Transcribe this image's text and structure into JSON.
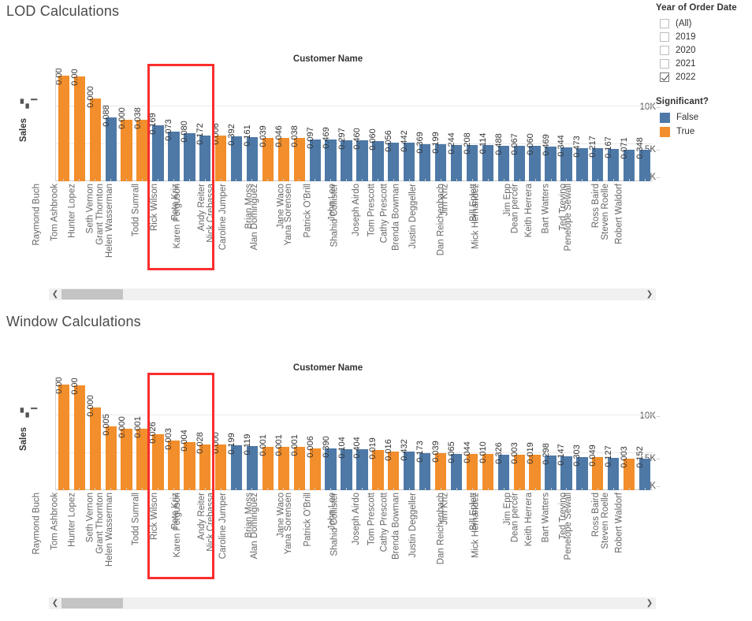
{
  "filters": {
    "title": "Year of Order Date",
    "options": [
      {
        "label": "(All)",
        "checked": false
      },
      {
        "label": "2019",
        "checked": false
      },
      {
        "label": "2020",
        "checked": false
      },
      {
        "label": "2021",
        "checked": false
      },
      {
        "label": "2022",
        "checked": true
      }
    ]
  },
  "legend": {
    "title": "Significant?",
    "items": [
      {
        "label": "False",
        "color": "#4e79a7"
      },
      {
        "label": "True",
        "color": "#f28e2b"
      }
    ]
  },
  "colors": {
    "false_blue": "#4e79a7",
    "true_orange": "#f28e2b",
    "highlight_red": "#fb2e2e"
  },
  "charts": [
    {
      "title": "LOD Calculations",
      "column_header": "Customer Name",
      "y_axis_title": "Sales",
      "y_ticks": [
        "10K",
        "5K",
        "0K"
      ],
      "scrollbar": {
        "left_arrow": "❮",
        "right_arrow": "❯"
      },
      "highlight": {
        "from": "Todd Sumrall",
        "to": "Karen Ferguson"
      }
    },
    {
      "title": "Window Calculations",
      "column_header": "Customer Name",
      "y_axis_title": "Sales",
      "y_ticks": [
        "10K",
        "5K",
        "0K"
      ],
      "scrollbar": {
        "left_arrow": "❮",
        "right_arrow": "❯"
      },
      "highlight": {
        "from": "Todd Sumrall",
        "to": "Karen Ferguson"
      }
    }
  ],
  "chart_data": [
    {
      "type": "bar",
      "title": "LOD Calculations",
      "xlabel": "Customer Name",
      "ylabel": "Sales",
      "ylim": [
        0,
        15000
      ],
      "yticks": [
        0,
        5000,
        10000
      ],
      "ytick_labels": [
        "0K",
        "5K",
        "10K"
      ],
      "grid": true,
      "legend": "Significant?",
      "value_label_note": "p-value printed above each bar; bar height = Sales",
      "categories": [
        "Raymond Buch",
        "Tom Ashbrook",
        "Hunter Lopez",
        "Seth Vernon",
        "Grant Thornton",
        "Helen Wasserman",
        "Todd Sumrall",
        "Rick Wilson",
        "Pete Kriz",
        "Karen Ferguson",
        "Andy Reiter",
        "Nick Crebassa",
        "Caroline Jumper",
        "Brian Moss",
        "Alan Dominguez",
        "Jane Waco",
        "Yana Sorensen",
        "Patrick O'Brill",
        "John Lee",
        "Shahid Collister",
        "Joseph Airdo",
        "Tom Prescott",
        "Cathy Prescott",
        "Brenda Bowman",
        "Justin Deggeller",
        "Jim Kriz",
        "Dan Reichenbach",
        "Bill Eplett",
        "Mick Hernandez",
        "Jim Epp",
        "Dean percer",
        "Keith Herrera",
        "Bart Watters",
        "Ted Trevino",
        "Penelope Sewall",
        "Ross Baird",
        "Steven Roelle",
        "Robert Waldorf"
      ],
      "values": [
        14100,
        14000,
        11050,
        8450,
        8150,
        8150,
        7500,
        6650,
        6350,
        6100,
        6050,
        5950,
        5850,
        5800,
        5750,
        5750,
        5600,
        5550,
        5500,
        5450,
        5300,
        5150,
        5100,
        4950,
        4900,
        4850,
        4800,
        4800,
        4750,
        4700,
        4700,
        4650,
        4500,
        4450,
        4400,
        4350,
        4200,
        4150
      ],
      "data_labels": [
        "0.000",
        "0.000",
        "0.000",
        "0.088",
        "0.000",
        "0.038",
        "0.169",
        "0.073",
        "0.080",
        "0.172",
        "0.006",
        "0.392",
        "0.161",
        "0.039",
        "0.046",
        "0.038",
        "0.097",
        "0.469",
        "0.297",
        "0.460",
        "0.060",
        "0.056",
        "0.442",
        "0.369",
        "0.199",
        "0.244",
        "0.208",
        "0.114",
        "0.488",
        "0.067",
        "0.060",
        "0.469",
        "0.344",
        "0.473",
        "0.217",
        "0.167",
        "0.071",
        "0.348"
      ],
      "significant": [
        true,
        true,
        true,
        false,
        true,
        true,
        false,
        false,
        false,
        false,
        true,
        false,
        false,
        true,
        true,
        true,
        false,
        false,
        false,
        false,
        false,
        false,
        false,
        false,
        false,
        false,
        false,
        false,
        false,
        false,
        false,
        false,
        false,
        false,
        false,
        false,
        false,
        false
      ],
      "series": [
        {
          "name": "True",
          "color": "#f28e2b"
        },
        {
          "name": "False",
          "color": "#4e79a7"
        }
      ]
    },
    {
      "type": "bar",
      "title": "Window Calculations",
      "xlabel": "Customer Name",
      "ylabel": "Sales",
      "ylim": [
        0,
        15000
      ],
      "yticks": [
        0,
        5000,
        10000
      ],
      "ytick_labels": [
        "0K",
        "5K",
        "10K"
      ],
      "grid": true,
      "legend": "Significant?",
      "value_label_note": "p-value printed above each bar; bar height = Sales",
      "categories": [
        "Raymond Buch",
        "Tom Ashbrook",
        "Hunter Lopez",
        "Seth Vernon",
        "Grant Thornton",
        "Helen Wasserman",
        "Todd Sumrall",
        "Rick Wilson",
        "Pete Kriz",
        "Karen Ferguson",
        "Andy Reiter",
        "Nick Crebassa",
        "Caroline Jumper",
        "Brian Moss",
        "Alan Dominguez",
        "Jane Waco",
        "Yana Sorensen",
        "Patrick O'Brill",
        "John Lee",
        "Shahid Collister",
        "Joseph Airdo",
        "Tom Prescott",
        "Cathy Prescott",
        "Brenda Bowman",
        "Justin Deggeller",
        "Jim Kriz",
        "Dan Reichenbach",
        "Bill Eplett",
        "Mick Hernandez",
        "Jim Epp",
        "Dean percer",
        "Keith Herrera",
        "Bart Watters",
        "Ted Trevino",
        "Penelope Sewall",
        "Ross Baird",
        "Steven Roelle",
        "Robert Waldorf"
      ],
      "values": [
        14100,
        14000,
        11050,
        8450,
        8150,
        8150,
        7500,
        6650,
        6350,
        6100,
        6050,
        5950,
        5850,
        5800,
        5750,
        5750,
        5600,
        5550,
        5500,
        5450,
        5300,
        5150,
        5100,
        4950,
        4900,
        4850,
        4800,
        4800,
        4750,
        4700,
        4700,
        4650,
        4500,
        4450,
        4400,
        4350,
        4200,
        4150
      ],
      "data_labels": [
        "0.000",
        "0.000",
        "0.000",
        "0.005",
        "0.000",
        "0.001",
        "0.026",
        "0.003",
        "0.004",
        "0.028",
        "0.000",
        "0.199",
        "0.119",
        "0.001",
        "0.001",
        "0.001",
        "0.006",
        "0.390",
        "0.104",
        "0.404",
        "0.019",
        "0.016",
        "0.432",
        "0.173",
        "0.039",
        "0.065",
        "0.044",
        "0.010",
        "0.326",
        "0.003",
        "0.019",
        "0.298",
        "0.147",
        "0.303",
        "0.049",
        "0.127",
        "0.003",
        "0.152"
      ],
      "significant": [
        true,
        true,
        true,
        true,
        true,
        true,
        true,
        true,
        true,
        true,
        true,
        false,
        false,
        true,
        true,
        true,
        true,
        false,
        false,
        false,
        true,
        true,
        false,
        false,
        true,
        false,
        true,
        true,
        false,
        true,
        true,
        false,
        false,
        false,
        true,
        false,
        true,
        false
      ],
      "series": [
        {
          "name": "True",
          "color": "#f28e2b"
        },
        {
          "name": "False",
          "color": "#4e79a7"
        }
      ]
    }
  ]
}
